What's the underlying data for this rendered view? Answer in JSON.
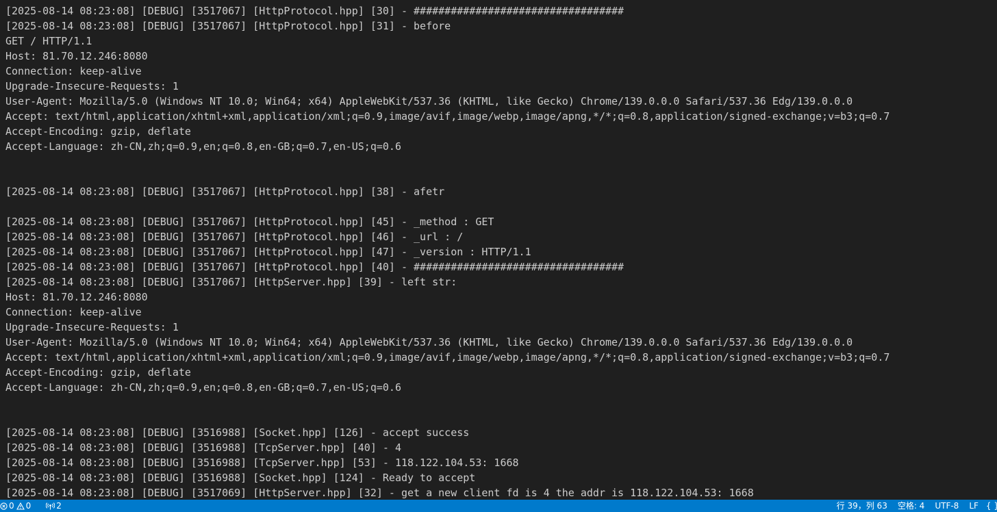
{
  "terminal": {
    "lines": [
      "[2025-08-14 08:23:08] [DEBUG] [3517067] [HttpProtocol.hpp] [30] - ##################################",
      "[2025-08-14 08:23:08] [DEBUG] [3517067] [HttpProtocol.hpp] [31] - before",
      "GET / HTTP/1.1",
      "Host: 81.70.12.246:8080",
      "Connection: keep-alive",
      "Upgrade-Insecure-Requests: 1",
      "User-Agent: Mozilla/5.0 (Windows NT 10.0; Win64; x64) AppleWebKit/537.36 (KHTML, like Gecko) Chrome/139.0.0.0 Safari/537.36 Edg/139.0.0.0",
      "Accept: text/html,application/xhtml+xml,application/xml;q=0.9,image/avif,image/webp,image/apng,*/*;q=0.8,application/signed-exchange;v=b3;q=0.7",
      "Accept-Encoding: gzip, deflate",
      "Accept-Language: zh-CN,zh;q=0.9,en;q=0.8,en-GB;q=0.7,en-US;q=0.6",
      "",
      "",
      "[2025-08-14 08:23:08] [DEBUG] [3517067] [HttpProtocol.hpp] [38] - afetr",
      "",
      "[2025-08-14 08:23:08] [DEBUG] [3517067] [HttpProtocol.hpp] [45] - _method : GET",
      "[2025-08-14 08:23:08] [DEBUG] [3517067] [HttpProtocol.hpp] [46] - _url : /",
      "[2025-08-14 08:23:08] [DEBUG] [3517067] [HttpProtocol.hpp] [47] - _version : HTTP/1.1",
      "[2025-08-14 08:23:08] [DEBUG] [3517067] [HttpProtocol.hpp] [40] - ##################################",
      "[2025-08-14 08:23:08] [DEBUG] [3517067] [HttpServer.hpp] [39] - left str:",
      "Host: 81.70.12.246:8080",
      "Connection: keep-alive",
      "Upgrade-Insecure-Requests: 1",
      "User-Agent: Mozilla/5.0 (Windows NT 10.0; Win64; x64) AppleWebKit/537.36 (KHTML, like Gecko) Chrome/139.0.0.0 Safari/537.36 Edg/139.0.0.0",
      "Accept: text/html,application/xhtml+xml,application/xml;q=0.9,image/avif,image/webp,image/apng,*/*;q=0.8,application/signed-exchange;v=b3;q=0.7",
      "Accept-Encoding: gzip, deflate",
      "Accept-Language: zh-CN,zh;q=0.9,en;q=0.8,en-GB;q=0.7,en-US;q=0.6",
      "",
      "",
      "[2025-08-14 08:23:08] [DEBUG] [3516988] [Socket.hpp] [126] - accept success",
      "[2025-08-14 08:23:08] [DEBUG] [3516988] [TcpServer.hpp] [40] - 4",
      "[2025-08-14 08:23:08] [DEBUG] [3516988] [TcpServer.hpp] [53] - 118.122.104.53: 1668",
      "[2025-08-14 08:23:08] [DEBUG] [3516988] [Socket.hpp] [124] - Ready to accept",
      "[2025-08-14 08:23:08] [DEBUG] [3517069] [HttpServer.hpp] [32] - get a new client fd is 4 the addr is 118.122.104.53: 1668"
    ]
  },
  "statusbar": {
    "errors_count": "0",
    "warnings_count": "0",
    "ports_count": "2",
    "cursor_position": "行 39，列 63",
    "indentation": "空格: 4",
    "encoding": "UTF-8",
    "eol": "LF",
    "language_icon": "{ }",
    "icons": {
      "errors": "error-circle-icon",
      "warnings": "warning-triangle-icon",
      "ports": "broadcast-icon",
      "language": "braces-icon"
    },
    "colors": {
      "background": "#007acc",
      "foreground": "#ffffff",
      "terminal_background": "#1f1f1f",
      "terminal_text": "#cccccc"
    }
  }
}
